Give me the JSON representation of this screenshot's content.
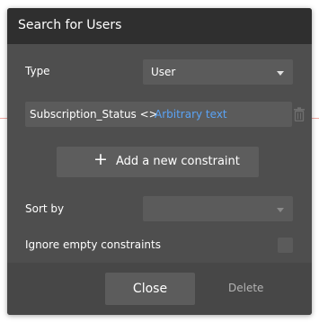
{
  "dialog": {
    "title": "Search for Users",
    "type_label": "Type",
    "type_value": "User",
    "constraint": {
      "field": "Subscription_Status <>",
      "value": "Arbitrary text"
    },
    "add_constraint_label": "Add a new constraint",
    "sort_by_label": "Sort by",
    "sort_by_value": "",
    "ignore_empty_label": "Ignore empty constraints",
    "ignore_empty_checked": false,
    "close_label": "Close",
    "delete_label": "Delete"
  },
  "colors": {
    "dialog_bg": "#4e4e4e",
    "titlebar_bg": "#2f2f2f",
    "input_bg": "#5b5b5b",
    "link_blue": "#5aa3f5"
  },
  "icons": {
    "type_dropdown": "chevron-down-icon",
    "sort_dropdown": "chevron-down-icon",
    "remove_constraint": "trash-icon",
    "add_constraint": "plus-icon"
  }
}
